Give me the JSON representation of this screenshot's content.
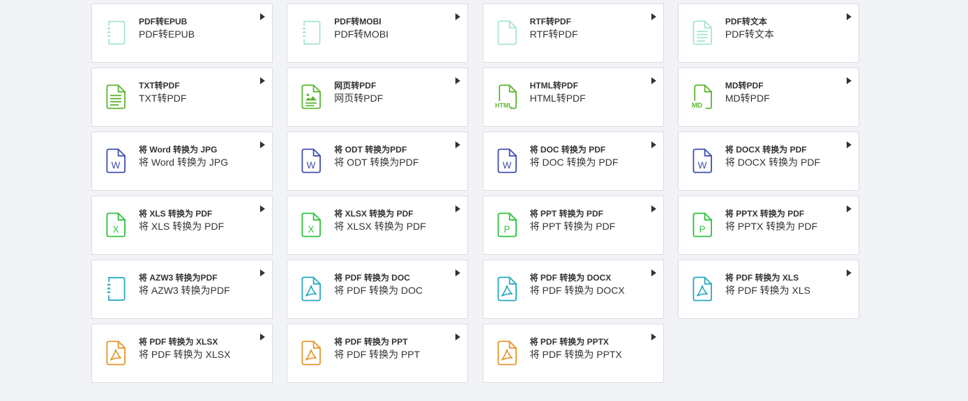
{
  "tools": [
    {
      "title": "PDF转EPUB",
      "desc": "PDF转EPUB",
      "icon": "ebook-icon",
      "color": "#a8e6c9"
    },
    {
      "title": "PDF转MOBI",
      "desc": "PDF转MOBI",
      "icon": "ebook-icon",
      "color": "#a8e6c9"
    },
    {
      "title": "RTF转PDF",
      "desc": "RTF转PDF",
      "icon": "file-blank-icon",
      "color": "#a8e6c9"
    },
    {
      "title": "PDF转文本",
      "desc": "PDF转文本",
      "icon": "file-text-icon",
      "color": "#a8e6c9"
    },
    {
      "title": "TXT转PDF",
      "desc": "TXT转PDF",
      "icon": "file-text-icon",
      "color": "#5cb531"
    },
    {
      "title": "网页转PDF",
      "desc": "网页转PDF",
      "icon": "file-image-icon",
      "color": "#5cb531"
    },
    {
      "title": "HTML转PDF",
      "desc": "HTML转PDF",
      "icon": "html-file-icon",
      "color": "#5cb531",
      "tag": "HTML"
    },
    {
      "title": "MD转PDF",
      "desc": "MD转PDF",
      "icon": "md-file-icon",
      "color": "#5cb531",
      "tag": "MD"
    },
    {
      "title": "将 Word 转换为 JPG",
      "desc": "将 Word 转换为 JPG",
      "icon": "word-file-icon",
      "color": "#3f4fae",
      "letter": "W"
    },
    {
      "title": "将 ODT 转换为PDF",
      "desc": "将 ODT 转换为PDF",
      "icon": "word-file-icon",
      "color": "#3f4fae",
      "letter": "W"
    },
    {
      "title": "将 DOC 转换为 PDF",
      "desc": "将 DOC 转换为 PDF",
      "icon": "word-file-icon",
      "color": "#3f4fae",
      "letter": "W"
    },
    {
      "title": "将 DOCX 转换为 PDF",
      "desc": "将 DOCX 转换为 PDF",
      "icon": "word-file-icon",
      "color": "#3f4fae",
      "letter": "W"
    },
    {
      "title": "将 XLS 转换为 PDF",
      "desc": "将 XLS 转换为 PDF",
      "icon": "excel-file-icon",
      "color": "#2ec13e",
      "letter": "X"
    },
    {
      "title": "将 XLSX 转换为 PDF",
      "desc": "将 XLSX 转换为 PDF",
      "icon": "excel-file-icon",
      "color": "#2ec13e",
      "letter": "X"
    },
    {
      "title": "将 PPT 转换为 PDF",
      "desc": "将 PPT 转换为 PDF",
      "icon": "ppt-file-icon",
      "color": "#2ec13e",
      "letter": "P"
    },
    {
      "title": "将 PPTX 转换为 PDF",
      "desc": "将 PPTX 转换为 PDF",
      "icon": "ppt-file-icon",
      "color": "#2ec13e",
      "letter": "P"
    },
    {
      "title": "将 AZW3 转换为PDF",
      "desc": "将 AZW3 转换为PDF",
      "icon": "ebook-icon",
      "color": "#26a9bf"
    },
    {
      "title": "将 PDF 转换为 DOC",
      "desc": "将 PDF 转换为 DOC",
      "icon": "pdf-file-icon",
      "color": "#26a9bf"
    },
    {
      "title": "将 PDF 转换为 DOCX",
      "desc": "将 PDF 转换为 DOCX",
      "icon": "pdf-file-icon",
      "color": "#26a9bf"
    },
    {
      "title": "将 PDF 转换为 XLS",
      "desc": "将 PDF 转换为 XLS",
      "icon": "pdf-file-icon",
      "color": "#26a9bf"
    },
    {
      "title": "将 PDF 转换为 XLSX",
      "desc": "将 PDF 转换为 XLSX",
      "icon": "pdf-file-icon",
      "color": "#e3952b"
    },
    {
      "title": "将 PDF 转换为 PPT",
      "desc": "将 PDF 转换为 PPT",
      "icon": "pdf-file-icon",
      "color": "#e3952b"
    },
    {
      "title": "将 PDF 转换为 PPTX",
      "desc": "将 PDF 转换为 PPTX",
      "icon": "pdf-file-icon",
      "color": "#e3952b"
    }
  ]
}
